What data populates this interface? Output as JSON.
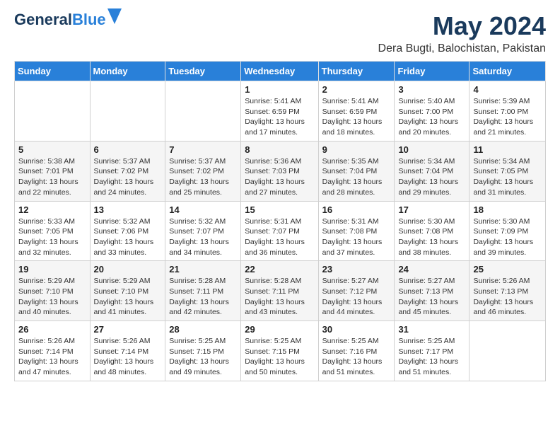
{
  "logo": {
    "line1": "General",
    "line2": "Blue"
  },
  "title": "May 2024",
  "location": "Dera Bugti, Balochistan, Pakistan",
  "days_of_week": [
    "Sunday",
    "Monday",
    "Tuesday",
    "Wednesday",
    "Thursday",
    "Friday",
    "Saturday"
  ],
  "weeks": [
    [
      {
        "day": "",
        "sunrise": "",
        "sunset": "",
        "daylight": ""
      },
      {
        "day": "",
        "sunrise": "",
        "sunset": "",
        "daylight": ""
      },
      {
        "day": "",
        "sunrise": "",
        "sunset": "",
        "daylight": ""
      },
      {
        "day": "1",
        "sunrise": "Sunrise: 5:41 AM",
        "sunset": "Sunset: 6:59 PM",
        "daylight": "Daylight: 13 hours and 17 minutes."
      },
      {
        "day": "2",
        "sunrise": "Sunrise: 5:41 AM",
        "sunset": "Sunset: 6:59 PM",
        "daylight": "Daylight: 13 hours and 18 minutes."
      },
      {
        "day": "3",
        "sunrise": "Sunrise: 5:40 AM",
        "sunset": "Sunset: 7:00 PM",
        "daylight": "Daylight: 13 hours and 20 minutes."
      },
      {
        "day": "4",
        "sunrise": "Sunrise: 5:39 AM",
        "sunset": "Sunset: 7:00 PM",
        "daylight": "Daylight: 13 hours and 21 minutes."
      }
    ],
    [
      {
        "day": "5",
        "sunrise": "Sunrise: 5:38 AM",
        "sunset": "Sunset: 7:01 PM",
        "daylight": "Daylight: 13 hours and 22 minutes."
      },
      {
        "day": "6",
        "sunrise": "Sunrise: 5:37 AM",
        "sunset": "Sunset: 7:02 PM",
        "daylight": "Daylight: 13 hours and 24 minutes."
      },
      {
        "day": "7",
        "sunrise": "Sunrise: 5:37 AM",
        "sunset": "Sunset: 7:02 PM",
        "daylight": "Daylight: 13 hours and 25 minutes."
      },
      {
        "day": "8",
        "sunrise": "Sunrise: 5:36 AM",
        "sunset": "Sunset: 7:03 PM",
        "daylight": "Daylight: 13 hours and 27 minutes."
      },
      {
        "day": "9",
        "sunrise": "Sunrise: 5:35 AM",
        "sunset": "Sunset: 7:04 PM",
        "daylight": "Daylight: 13 hours and 28 minutes."
      },
      {
        "day": "10",
        "sunrise": "Sunrise: 5:34 AM",
        "sunset": "Sunset: 7:04 PM",
        "daylight": "Daylight: 13 hours and 29 minutes."
      },
      {
        "day": "11",
        "sunrise": "Sunrise: 5:34 AM",
        "sunset": "Sunset: 7:05 PM",
        "daylight": "Daylight: 13 hours and 31 minutes."
      }
    ],
    [
      {
        "day": "12",
        "sunrise": "Sunrise: 5:33 AM",
        "sunset": "Sunset: 7:05 PM",
        "daylight": "Daylight: 13 hours and 32 minutes."
      },
      {
        "day": "13",
        "sunrise": "Sunrise: 5:32 AM",
        "sunset": "Sunset: 7:06 PM",
        "daylight": "Daylight: 13 hours and 33 minutes."
      },
      {
        "day": "14",
        "sunrise": "Sunrise: 5:32 AM",
        "sunset": "Sunset: 7:07 PM",
        "daylight": "Daylight: 13 hours and 34 minutes."
      },
      {
        "day": "15",
        "sunrise": "Sunrise: 5:31 AM",
        "sunset": "Sunset: 7:07 PM",
        "daylight": "Daylight: 13 hours and 36 minutes."
      },
      {
        "day": "16",
        "sunrise": "Sunrise: 5:31 AM",
        "sunset": "Sunset: 7:08 PM",
        "daylight": "Daylight: 13 hours and 37 minutes."
      },
      {
        "day": "17",
        "sunrise": "Sunrise: 5:30 AM",
        "sunset": "Sunset: 7:08 PM",
        "daylight": "Daylight: 13 hours and 38 minutes."
      },
      {
        "day": "18",
        "sunrise": "Sunrise: 5:30 AM",
        "sunset": "Sunset: 7:09 PM",
        "daylight": "Daylight: 13 hours and 39 minutes."
      }
    ],
    [
      {
        "day": "19",
        "sunrise": "Sunrise: 5:29 AM",
        "sunset": "Sunset: 7:10 PM",
        "daylight": "Daylight: 13 hours and 40 minutes."
      },
      {
        "day": "20",
        "sunrise": "Sunrise: 5:29 AM",
        "sunset": "Sunset: 7:10 PM",
        "daylight": "Daylight: 13 hours and 41 minutes."
      },
      {
        "day": "21",
        "sunrise": "Sunrise: 5:28 AM",
        "sunset": "Sunset: 7:11 PM",
        "daylight": "Daylight: 13 hours and 42 minutes."
      },
      {
        "day": "22",
        "sunrise": "Sunrise: 5:28 AM",
        "sunset": "Sunset: 7:11 PM",
        "daylight": "Daylight: 13 hours and 43 minutes."
      },
      {
        "day": "23",
        "sunrise": "Sunrise: 5:27 AM",
        "sunset": "Sunset: 7:12 PM",
        "daylight": "Daylight: 13 hours and 44 minutes."
      },
      {
        "day": "24",
        "sunrise": "Sunrise: 5:27 AM",
        "sunset": "Sunset: 7:13 PM",
        "daylight": "Daylight: 13 hours and 45 minutes."
      },
      {
        "day": "25",
        "sunrise": "Sunrise: 5:26 AM",
        "sunset": "Sunset: 7:13 PM",
        "daylight": "Daylight: 13 hours and 46 minutes."
      }
    ],
    [
      {
        "day": "26",
        "sunrise": "Sunrise: 5:26 AM",
        "sunset": "Sunset: 7:14 PM",
        "daylight": "Daylight: 13 hours and 47 minutes."
      },
      {
        "day": "27",
        "sunrise": "Sunrise: 5:26 AM",
        "sunset": "Sunset: 7:14 PM",
        "daylight": "Daylight: 13 hours and 48 minutes."
      },
      {
        "day": "28",
        "sunrise": "Sunrise: 5:25 AM",
        "sunset": "Sunset: 7:15 PM",
        "daylight": "Daylight: 13 hours and 49 minutes."
      },
      {
        "day": "29",
        "sunrise": "Sunrise: 5:25 AM",
        "sunset": "Sunset: 7:15 PM",
        "daylight": "Daylight: 13 hours and 50 minutes."
      },
      {
        "day": "30",
        "sunrise": "Sunrise: 5:25 AM",
        "sunset": "Sunset: 7:16 PM",
        "daylight": "Daylight: 13 hours and 51 minutes."
      },
      {
        "day": "31",
        "sunrise": "Sunrise: 5:25 AM",
        "sunset": "Sunset: 7:17 PM",
        "daylight": "Daylight: 13 hours and 51 minutes."
      },
      {
        "day": "",
        "sunrise": "",
        "sunset": "",
        "daylight": ""
      }
    ]
  ]
}
